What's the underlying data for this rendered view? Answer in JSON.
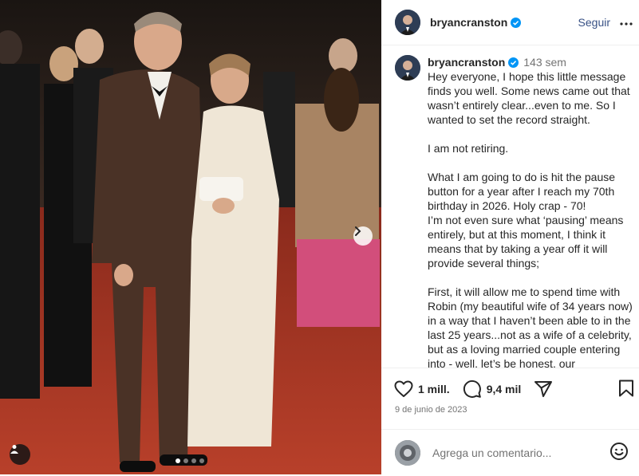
{
  "colors": {
    "accent": "#0095f6",
    "text": "#262626",
    "muted": "#737373",
    "carpet": "#a8321f"
  },
  "media": {
    "carousel_count": 4,
    "active_index": 0
  },
  "header": {
    "username": "bryancranston",
    "follow_label": "Seguir",
    "more_icon": "more-horizontal-icon"
  },
  "caption": {
    "username": "bryancranston",
    "age": "143 sem",
    "text": "Hey everyone, I hope this little message finds you well. Some news came out that wasn’t entirely clear...even to me. So I wanted to set the record straight.\n\nI am not retiring.\n\nWhat I am going to do is hit the pause button for a year after I reach my 70th birthday in 2026. Holy crap - 70!\nI’m not even sure what ‘pausing’ means entirely, but at this moment, I think it means that by taking a year off it will provide several things;\n\nFirst, it will allow me to spend time with Robin (my beautiful wife of 34 years now) in a way that I haven’t been able to in the last 25 years...not as a wife of a celebrity, but as a loving married couple entering into - well, let’s be honest, our"
  },
  "actions": {
    "likes": "1 mill.",
    "comments": "9,4 mil",
    "date": "9 de junio de 2023"
  },
  "comment_box": {
    "placeholder": "Agrega un comentario..."
  }
}
